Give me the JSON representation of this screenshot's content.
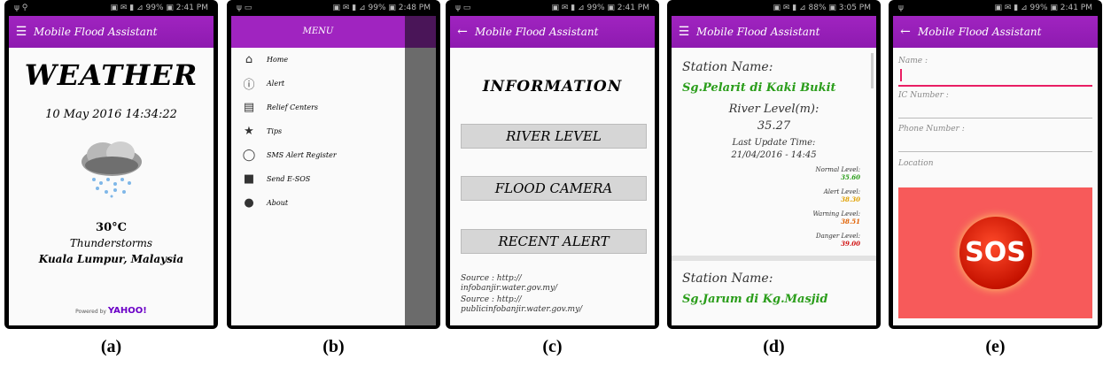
{
  "status": {
    "a": {
      "left": "ψ ⚲",
      "right": "▣ ✉ ▮ ⊿ 99% ▣ 2:41 PM"
    },
    "b": {
      "left": "ψ ▭",
      "right": "▣ ✉ ▮ ⊿ 99% ▣ 2:48 PM"
    },
    "c": {
      "left": "ψ ▭",
      "right": "▣ ✉ ▮ ⊿ 99% ▣ 2:41 PM"
    },
    "d": {
      "left": "",
      "right": "▣ ✉ ▮ ⊿ 88% ▣ 3:05 PM"
    },
    "e": {
      "left": "ψ",
      "right": "▣ ✉ ▮ ⊿ 99% ▣ 2:41 PM"
    }
  },
  "app_title": "Mobile Flood Assistant",
  "screen_a": {
    "title": "WEATHER",
    "datetime": "10 May 2016 14:34:22",
    "temperature": "30°C",
    "condition": "Thunderstorms",
    "location": "Kuala Lumpur, Malaysia",
    "powered_prefix": "Powered by",
    "powered_brand": "YAHOO!",
    "caption": "(a)"
  },
  "screen_b": {
    "menu_title": "MENU",
    "items": [
      {
        "icon": "home-icon",
        "glyph": "⌂",
        "label": "Home"
      },
      {
        "icon": "alert-icon",
        "glyph": "ⓘ",
        "label": "Alert"
      },
      {
        "icon": "map-icon",
        "glyph": "▤",
        "label": "Relief Centers"
      },
      {
        "icon": "star-icon",
        "glyph": "★",
        "label": "Tips"
      },
      {
        "icon": "chat-icon",
        "glyph": "◯",
        "label": "SMS Alert Register"
      },
      {
        "icon": "square-icon",
        "glyph": "■",
        "label": "Send E-SOS"
      },
      {
        "icon": "info-icon",
        "glyph": "●",
        "label": "About"
      }
    ],
    "caption": "(b)"
  },
  "screen_c": {
    "title": "INFORMATION",
    "buttons": [
      "RIVER LEVEL",
      "FLOOD CAMERA",
      "RECENT ALERT"
    ],
    "source1": "Source : http://\ninfobanjir.water.gov.my/",
    "source2": "Source : http://\npublicinfobanjir.water.gov.my/",
    "caption": "(c)"
  },
  "screen_d": {
    "station_label": "Station Name:",
    "station1": "Sg.Pelarit di Kaki Bukit",
    "river_level_label": "River Level(m):",
    "river_level": "35.27",
    "last_update_label": "Last Update Time:",
    "last_update": "21/04/2016 - 14:45",
    "levels": [
      {
        "label": "Normal Level:",
        "value": "35.60",
        "color": "#2a9d1a"
      },
      {
        "label": "Alert Level:",
        "value": "38.30",
        "color": "#e0a000"
      },
      {
        "label": "Warning Level:",
        "value": "38.51",
        "color": "#e06000"
      },
      {
        "label": "Danger Level:",
        "value": "39.00",
        "color": "#d01010"
      }
    ],
    "station2_label": "Station Name:",
    "station2": "Sg.Jarum di Kg.Masjid",
    "caption": "(d)"
  },
  "screen_e": {
    "fields": [
      "Name :",
      "IC Number :",
      "Phone Number :",
      "Location"
    ],
    "sos_label": "SOS",
    "caption": "(e)"
  }
}
